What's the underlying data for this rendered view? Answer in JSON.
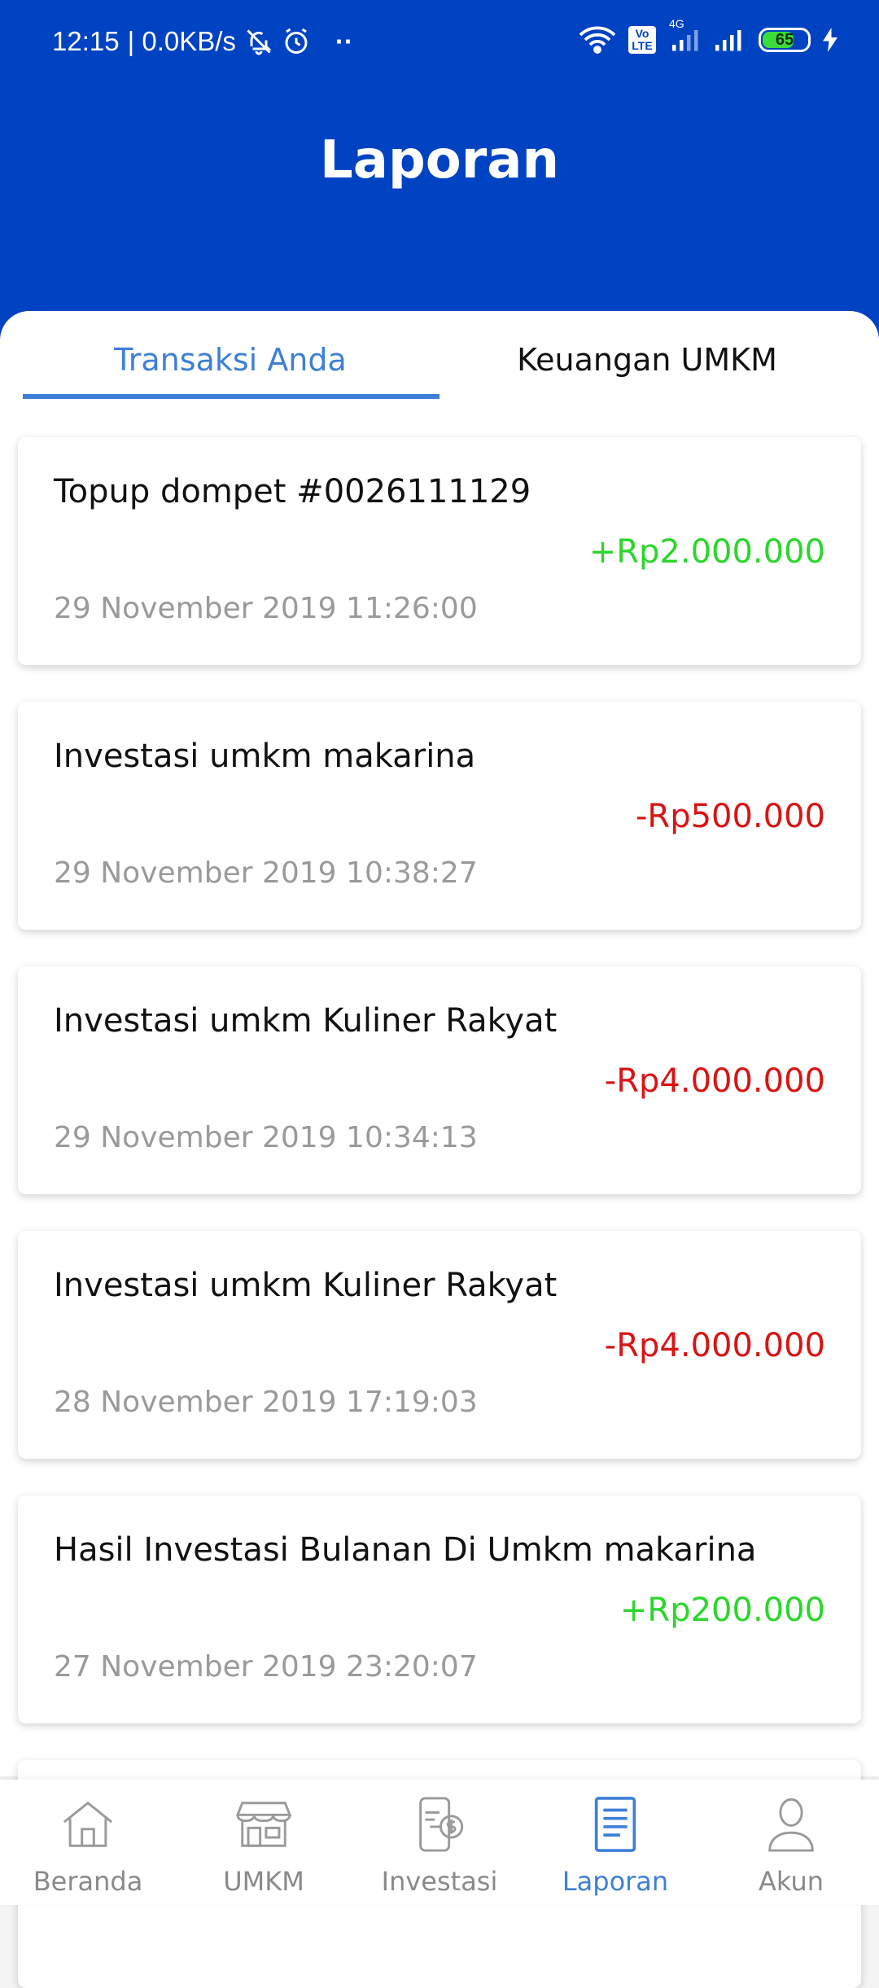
{
  "status_bar": {
    "time": "12:15",
    "network_speed": "| 0.0KB/s",
    "dots": "··",
    "volte": "Vo LTE",
    "net_type": "4G",
    "battery_level": "65"
  },
  "header": {
    "title": "Laporan"
  },
  "tabs": [
    {
      "label": "Transaksi Anda",
      "active": true
    },
    {
      "label": "Keuangan UMKM",
      "active": false
    }
  ],
  "transactions": [
    {
      "title": "Topup dompet #0026111129",
      "amount": "+Rp2.000.000",
      "date": "29 November 2019 11:26:00"
    },
    {
      "title": "Investasi umkm makarina",
      "amount": "-Rp500.000",
      "date": "29 November 2019 10:38:27"
    },
    {
      "title": "Investasi umkm Kuliner Rakyat",
      "amount": "-Rp4.000.000",
      "date": "29 November 2019 10:34:13"
    },
    {
      "title": "Investasi umkm Kuliner Rakyat",
      "amount": "-Rp4.000.000",
      "date": "28 November 2019 17:19:03"
    },
    {
      "title": "Hasil Investasi Bulanan Di Umkm makarina",
      "amount": "+Rp200.000",
      "date": "27 November 2019 23:20:07"
    }
  ],
  "bottom_nav": [
    {
      "label": "Beranda",
      "icon": "home-icon"
    },
    {
      "label": "UMKM",
      "icon": "store-icon"
    },
    {
      "label": "Investasi",
      "icon": "investment-icon"
    },
    {
      "label": "Laporan",
      "icon": "report-icon",
      "active": true
    },
    {
      "label": "Akun",
      "icon": "user-icon"
    }
  ],
  "colors": {
    "primary": "#0043c2",
    "accent": "#3e7fd8",
    "positive": "#2bd62b",
    "negative": "#d81414"
  }
}
